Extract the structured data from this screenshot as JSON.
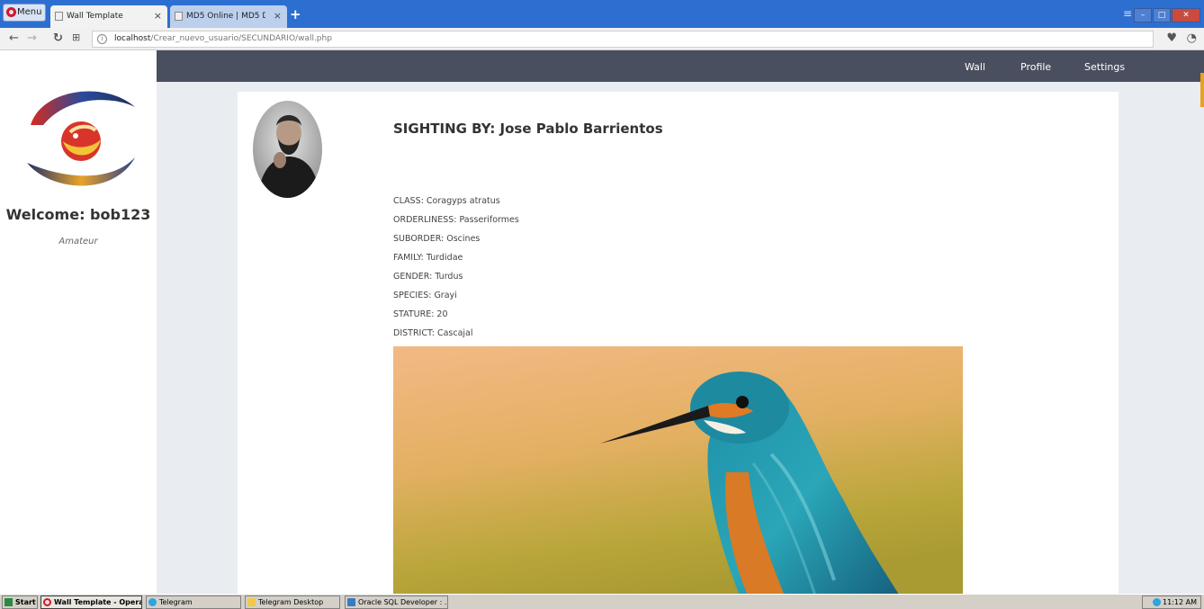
{
  "browser": {
    "menu_label": "Menu",
    "tabs": [
      {
        "title": "Wall Template"
      },
      {
        "title": "MD5 Online | MD5 Decrypter"
      }
    ],
    "new_tab": "+",
    "url_host": "localhost",
    "url_path": "/Crear_nuevo_usuario/SECUNDARIO/wall.php"
  },
  "sidebar": {
    "welcome": "Welcome: bob123",
    "role": "Amateur"
  },
  "nav": {
    "wall": "Wall",
    "profile": "Profile",
    "settings": "Settings"
  },
  "post": {
    "title": "SIGHTING BY: Jose Pablo Barrientos",
    "fields": [
      "CLASS: Coragyps atratus",
      "ORDERLINESS: Passeriformes",
      "SUBORDER: Oscines",
      "FAMILY: Turdidae",
      "GENDER: Turdus",
      "SPECIES: Grayi",
      "STATURE: 20",
      "DISTRICT: Cascajal"
    ]
  },
  "taskbar": {
    "start": "Start",
    "items": [
      "Wall Template - Opera",
      "Telegram",
      "Telegram Desktop",
      "Oracle SQL Developer : ..."
    ],
    "clock": "11:12 AM"
  },
  "colors": {
    "browser_chrome": "#2d6fd1",
    "top_nav": "#4a4f5f",
    "page_bg": "#e9ecf1",
    "accent": "#e9a21c"
  }
}
